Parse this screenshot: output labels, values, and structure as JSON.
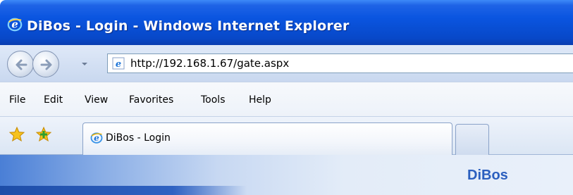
{
  "window": {
    "title": "DiBos - Login - Windows Internet Explorer",
    "icon": "ie-logo-icon"
  },
  "navigation": {
    "back_icon": "back-arrow-icon",
    "forward_icon": "forward-arrow-icon",
    "history_dropdown_icon": "chevron-down-icon",
    "address": {
      "url": "http://192.168.1.67/gate.aspx",
      "icon": "page-ie-icon"
    }
  },
  "menubar": {
    "items": [
      "File",
      "Edit",
      "View",
      "Favorites",
      "Tools",
      "Help"
    ]
  },
  "tabs": {
    "favorites_icon": "favorites-star-icon",
    "add_favorite_icon": "add-favorite-icon",
    "active_tab": {
      "label": "DiBos - Login",
      "icon": "ie-logo-icon"
    },
    "new_tab_icon": "new-tab-icon"
  },
  "page": {
    "brand": "DiBos"
  },
  "colors": {
    "titlebar": "#0a55e0",
    "brand_text": "#2b5fbf",
    "content_gradient_start": "#4a7fd6",
    "content_gradient_end": "#e9f0fa"
  }
}
